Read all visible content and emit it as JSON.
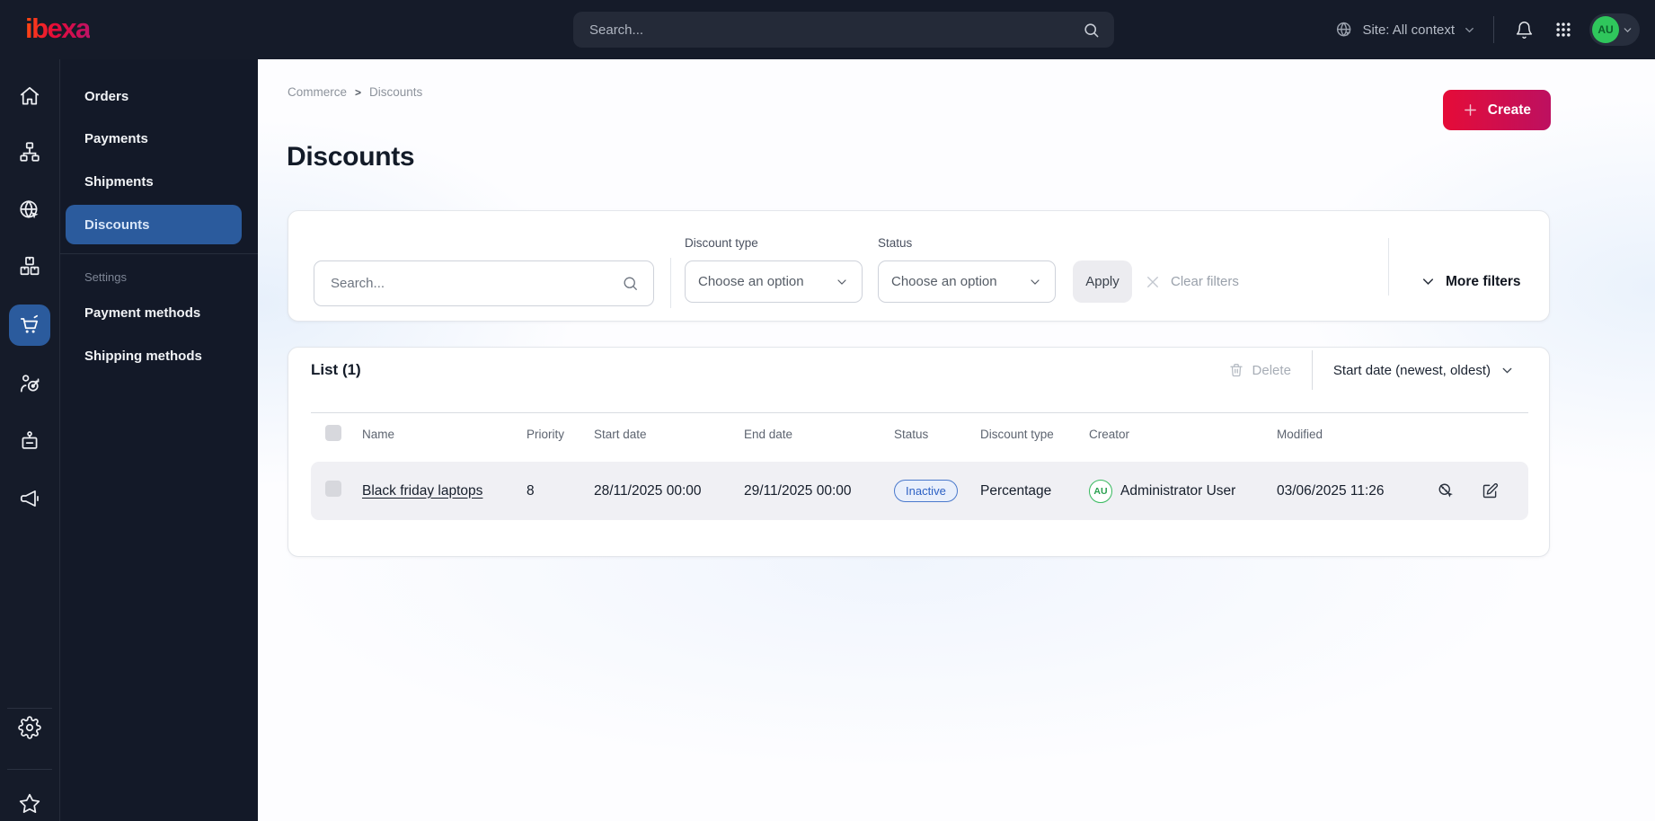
{
  "topbar": {
    "logo": "ibexa",
    "search_placeholder": "Search...",
    "site_context": "Site: All context",
    "avatar_initials": "AU"
  },
  "sidebar": {
    "icons": [
      {
        "name": "home"
      },
      {
        "name": "content-tree"
      },
      {
        "name": "site"
      },
      {
        "name": "products"
      },
      {
        "name": "commerce",
        "active": true
      },
      {
        "name": "customer-targeting"
      },
      {
        "name": "members-badge"
      },
      {
        "name": "marketing"
      },
      {
        "name": "admin-settings"
      },
      {
        "name": "bookmarks"
      }
    ]
  },
  "submenu": {
    "items": [
      {
        "label": "Orders"
      },
      {
        "label": "Payments"
      },
      {
        "label": "Shipments"
      },
      {
        "label": "Discounts",
        "active": true
      }
    ],
    "section_label": "Settings",
    "settings_items": [
      {
        "label": "Payment methods"
      },
      {
        "label": "Shipping methods"
      }
    ]
  },
  "breadcrumb": {
    "items": [
      "Commerce",
      "Discounts"
    ],
    "separator": ">"
  },
  "page": {
    "title": "Discounts",
    "create_label": "Create"
  },
  "filters": {
    "search_placeholder": "Search...",
    "discount_type_label": "Discount type",
    "discount_type_value": "Choose an option",
    "status_label": "Status",
    "status_value": "Choose an option",
    "apply_label": "Apply",
    "clear_label": "Clear filters",
    "more_label": "More filters"
  },
  "list": {
    "title": "List (1)",
    "delete_label": "Delete",
    "sort_label": "Start date (newest, oldest)",
    "columns": [
      "Name",
      "Priority",
      "Start date",
      "End date",
      "Status",
      "Discount type",
      "Creator",
      "Modified"
    ],
    "rows": [
      {
        "name": "Black friday laptops",
        "priority": "8",
        "start_date": "28/11/2025 00:00",
        "end_date": "29/11/2025 00:00",
        "status": "Inactive",
        "discount_type": "Percentage",
        "creator_initials": "AU",
        "creator": "Administrator User",
        "modified": "03/06/2025 11:26"
      }
    ]
  },
  "colors": {
    "topbar_bg": "#151b29",
    "active_blue": "#2b5b9d",
    "brand_gradient_start": "#e50c38",
    "brand_gradient_end": "#bd1060",
    "status_inactive_text": "#2d61c4",
    "status_inactive_bg": "#e9effb",
    "avatar_green": "#2fc65c",
    "row_bg": "#f0f0f4"
  }
}
